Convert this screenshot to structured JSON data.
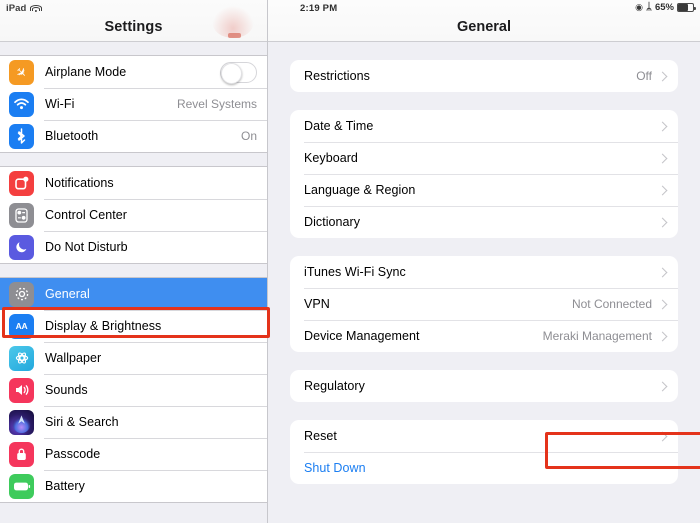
{
  "statusbar": {
    "device_label": "iPad",
    "wifi_icon": "wifi-icon",
    "time": "2:19 PM",
    "rotation_lock_icon": "rotation-lock-icon",
    "bluetooth_icon": "bluetooth-icon",
    "battery_percent": "65%",
    "battery_level": 65
  },
  "sidebar": {
    "title": "Settings",
    "groups": [
      {
        "rows": [
          {
            "label": "Airplane Mode",
            "icon": "airplane-icon",
            "glyph": "✈",
            "accessory": "toggle",
            "toggle_on": false,
            "value": ""
          },
          {
            "label": "Wi-Fi",
            "icon": "wifi-icon",
            "glyph": "",
            "accessory": "value",
            "value": "Revel Systems"
          },
          {
            "label": "Bluetooth",
            "icon": "bluetooth-icon",
            "glyph": "ᛦ",
            "accessory": "value",
            "value": "On"
          }
        ]
      },
      {
        "rows": [
          {
            "label": "Notifications",
            "icon": "notifications-icon",
            "glyph": "",
            "accessory": "none",
            "value": ""
          },
          {
            "label": "Control Center",
            "icon": "control-center-icon",
            "glyph": "",
            "accessory": "none",
            "value": ""
          },
          {
            "label": "Do Not Disturb",
            "icon": "do-not-disturb-icon",
            "glyph": "☾",
            "accessory": "none",
            "value": ""
          }
        ]
      },
      {
        "rows": [
          {
            "label": "General",
            "icon": "gear-icon",
            "glyph": "⚙",
            "accessory": "none",
            "value": "",
            "selected": true
          },
          {
            "label": "Display & Brightness",
            "icon": "display-brightness-icon",
            "glyph": "AA",
            "accessory": "none",
            "value": ""
          },
          {
            "label": "Wallpaper",
            "icon": "wallpaper-icon",
            "glyph": "✻",
            "accessory": "none",
            "value": ""
          },
          {
            "label": "Sounds",
            "icon": "sounds-icon",
            "glyph": "🔊",
            "accessory": "none",
            "value": ""
          },
          {
            "label": "Siri & Search",
            "icon": "siri-icon",
            "glyph": "",
            "accessory": "none",
            "value": ""
          },
          {
            "label": "Passcode",
            "icon": "passcode-lock-icon",
            "glyph": "",
            "accessory": "none",
            "value": ""
          },
          {
            "label": "Battery",
            "icon": "battery-icon",
            "glyph": "",
            "accessory": "none",
            "value": ""
          }
        ]
      }
    ]
  },
  "detail": {
    "title": "General",
    "cards": [
      {
        "rows": [
          {
            "label": "Restrictions",
            "value": "Off",
            "chevron": true,
            "link": false
          }
        ]
      },
      {
        "rows": [
          {
            "label": "Date & Time",
            "value": "",
            "chevron": true,
            "link": false
          },
          {
            "label": "Keyboard",
            "value": "",
            "chevron": true,
            "link": false
          },
          {
            "label": "Language & Region",
            "value": "",
            "chevron": true,
            "link": false
          },
          {
            "label": "Dictionary",
            "value": "",
            "chevron": true,
            "link": false
          }
        ]
      },
      {
        "rows": [
          {
            "label": "iTunes Wi-Fi Sync",
            "value": "",
            "chevron": true,
            "link": false
          },
          {
            "label": "VPN",
            "value": "Not Connected",
            "chevron": true,
            "link": false
          },
          {
            "label": "Device Management",
            "value": "Meraki Management",
            "chevron": true,
            "link": false
          }
        ]
      },
      {
        "rows": [
          {
            "label": "Regulatory",
            "value": "",
            "chevron": true,
            "link": false
          }
        ]
      },
      {
        "rows": [
          {
            "label": "Reset",
            "value": "",
            "chevron": true,
            "link": false
          },
          {
            "label": "Shut Down",
            "value": "",
            "chevron": false,
            "link": true
          }
        ]
      }
    ]
  },
  "annotations": {
    "color": "#e4331b",
    "boxes": [
      {
        "target": "General",
        "name": "annotation-general"
      },
      {
        "target": "Reset",
        "name": "annotation-reset"
      }
    ]
  },
  "colors": {
    "selection_blue": "#3f8ef0",
    "link_blue": "#1b7ef2",
    "pane_background": "#efeff4",
    "card_white": "#ffffff",
    "secondary_text": "#8e8e93",
    "annotation_red": "#e4331b"
  }
}
